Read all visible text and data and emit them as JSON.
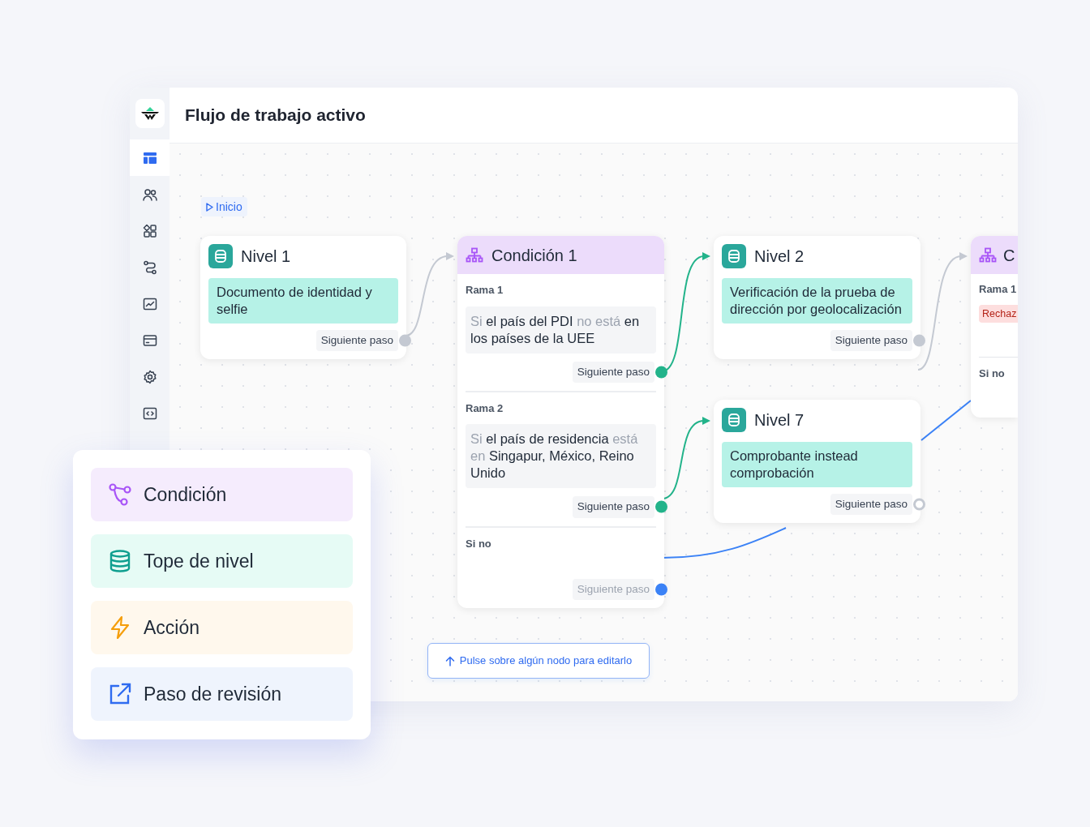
{
  "window": {
    "title": "Flujo de trabajo activo"
  },
  "sidebar": {
    "items": [
      {
        "selected": true
      },
      {
        "selected": false
      },
      {
        "selected": false
      },
      {
        "selected": false
      },
      {
        "selected": false
      },
      {
        "selected": false
      },
      {
        "selected": false
      },
      {
        "selected": false
      }
    ]
  },
  "canvas": {
    "start": {
      "label": "Inicio"
    },
    "nodes": [
      {
        "kind": "level",
        "title": "Nivel 1",
        "step": "Documento de identidad y selfie",
        "outlet": {
          "label": "Siguiente paso",
          "color": "#c4c9d2",
          "connected": true
        }
      },
      {
        "kind": "condition",
        "title": "Condición 1",
        "branches": [
          {
            "label": "Rama 1",
            "rule": [
              {
                "text": "Si",
                "muted": true
              },
              {
                "text": "el país del PDI",
                "muted": false
              },
              {
                "text": "no está",
                "muted": true
              },
              {
                "text": "en los países de la UEE",
                "muted": false
              }
            ],
            "outlet": {
              "label": "Siguiente paso",
              "color": "#22b38a",
              "connected": true,
              "disabled": false
            }
          },
          {
            "label": "Rama 2",
            "rule": [
              {
                "text": "Si",
                "muted": true
              },
              {
                "text": "el país de residencia",
                "muted": false
              },
              {
                "text": "está en",
                "muted": true
              },
              {
                "text": "Singapur, México, Reino Unido",
                "muted": false
              }
            ],
            "outlet": {
              "label": "Siguiente paso",
              "color": "#22b38a",
              "connected": true,
              "disabled": false
            }
          },
          {
            "label": "Si no",
            "outlet": {
              "label": "Siguiente paso",
              "color": "#3b82f6",
              "connected": true,
              "disabled": true
            }
          }
        ]
      },
      {
        "kind": "level",
        "title": "Nivel 2",
        "step": "Verificación de la prueba de dirección por geolocalización",
        "outlet": {
          "label": "Siguiente paso",
          "color": "#c4c9d2",
          "connected": true
        }
      },
      {
        "kind": "level",
        "title": "Nivel 7",
        "step": "Comprobante instead comprobación",
        "outlet": {
          "label": "Siguiente paso",
          "color": "#c4c9d2",
          "connected": false
        }
      },
      {
        "kind": "condition_cut",
        "title": "C",
        "branches": [
          {
            "label": "Rama 1",
            "tag": "Rechaz"
          },
          {
            "label": "Si no"
          }
        ]
      }
    ],
    "hint": "Pulse sobre algún nodo para editarlo"
  },
  "palette": {
    "items": [
      {
        "kind": "condition",
        "label": "Condición"
      },
      {
        "kind": "level",
        "label": "Tope de nivel"
      },
      {
        "kind": "action",
        "label": "Acción"
      },
      {
        "kind": "review",
        "label": "Paso de revisión"
      }
    ]
  }
}
